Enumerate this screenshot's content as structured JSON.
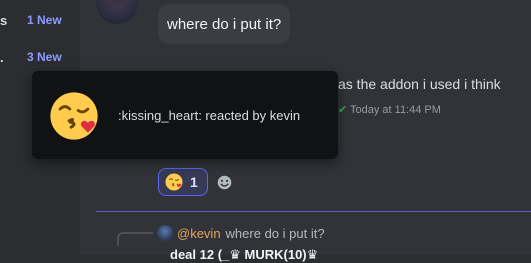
{
  "sidebar": {
    "rows": [
      {
        "fragment": "s",
        "badge": "1 New"
      },
      {
        "fragment": ".",
        "badge": "3 New"
      }
    ]
  },
  "messages": {
    "bubble_text": "where do i put it?",
    "partial_line": "as the addon i used i think",
    "timestamp": "Today at 11:44 PM"
  },
  "tooltip": {
    "emoji_icon": "kissing-heart-emoji",
    "text": ":kissing_heart: reacted by kevin"
  },
  "reaction": {
    "emoji_icon": "kissing-heart-emoji",
    "count": "1",
    "accent": "#5865f2"
  },
  "reply": {
    "mention": "@kevin",
    "text": "where do i put it?"
  },
  "cut_off_row": {
    "text": "deal 12 (_♛ MURK(10)♛"
  },
  "colors": {
    "sidebar_new": "#8c9bff",
    "mention": "#e0a45a",
    "divider": "#6d5bc4",
    "timestamp_check": "#3ba55d"
  }
}
